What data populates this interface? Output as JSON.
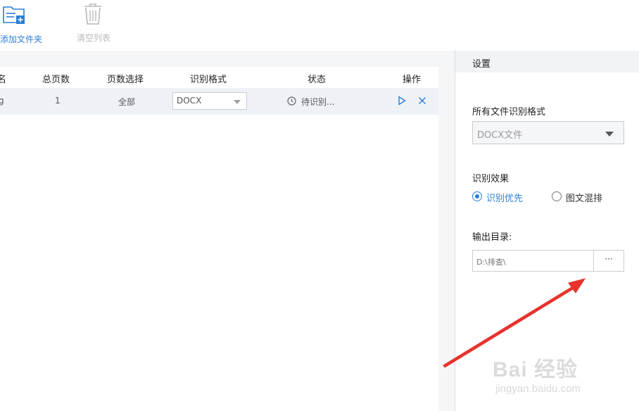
{
  "toolbar": {
    "add_folder_label": "添加文件夹",
    "clear_list_label": "清空列表"
  },
  "table": {
    "headers": {
      "name": "名",
      "total_pages": "总页数",
      "page_select": "页数选择",
      "format": "识别格式",
      "status": "状态",
      "actions": "操作"
    },
    "rows": [
      {
        "name_fragment": "g",
        "total_pages": "1",
        "page_select": "全部",
        "format": "DOCX",
        "status": "待识别..."
      }
    ]
  },
  "settings": {
    "title": "设置",
    "all_format_label": "所有文件识别格式",
    "all_format_value": "DOCX文件",
    "effect_label": "识别效果",
    "effect_options": [
      "识别优先",
      "图文混排"
    ],
    "effect_selected": "识别优先",
    "output_label": "输出目录:",
    "output_path": "D:\\排查\\",
    "browse_label": "···"
  },
  "watermark": {
    "text": "Bai 经验",
    "url": "jingyan.baidu.com"
  },
  "colors": {
    "accent": "#2a7fd6",
    "arrow": "#e8322d",
    "panel_bg": "#f5f6f8",
    "row_bg": "#eef2f7"
  }
}
